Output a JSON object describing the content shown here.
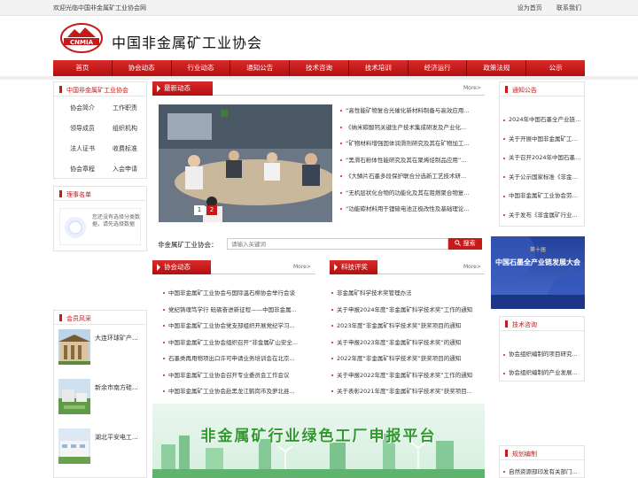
{
  "topbar": {
    "welcome": "欢迎光临中国非金属矿工业协会网",
    "set_home": "设为首页",
    "contact": "联系我们"
  },
  "header": {
    "logo_text": "CNMIA",
    "title": "中国非金属矿工业协会"
  },
  "nav": [
    "首页",
    "协会动态",
    "行业动态",
    "通知公告",
    "技术咨询",
    "技术培训",
    "经济运行",
    "政策法规",
    "公示"
  ],
  "left": {
    "assoc_title": "中国非金属矿工业协会",
    "assoc_links": [
      "协会简介",
      "工作职责",
      "领导成员",
      "组织机构",
      "法人证书",
      "收费标准",
      "协会章程",
      "入会申请"
    ],
    "council_title": "理事名单",
    "council_empty": "您还没有选择分类数据，请先选择数据",
    "members_title": "会员风采",
    "members": [
      "大连环球矿产...",
      "新余市南方硅...",
      "湖北平安电工..."
    ]
  },
  "news": {
    "title": "最新动态",
    "more": "More>",
    "items": [
      "“高性能矿物复合光催化新材料制备与高效应用...",
      "《纳米碳酸钙关键生产技术集成研发及产业化...",
      "“矿物材料增强固体润滑剂研究及其在矿物加工...",
      "“黑滑石粉体性能研究及其在聚烯烃制品应用”...",
      "《大鳞片石墨多段保护联合分选新工艺技术研...",
      "“无机层状化合物的功能化及其在阻燃聚合物复...",
      "“功能碳材料用于锂硫电池正极改性及基础理论..."
    ],
    "slide_numbers": [
      "1",
      "2"
    ]
  },
  "search": {
    "label": "非金属矿工业协会：",
    "placeholder": "请输入关键词",
    "button": "搜索"
  },
  "assoc_news": {
    "title": "协会动态",
    "more": "More>",
    "items": [
      "中国非金属矿工业协会与国际温石棉协会举行会谈",
      "党纪铸魂笃学行 砥砺奋进新征程——中国非金属...",
      "中国非金属矿工业协会党支部组织开展党纪学习...",
      "中国非金属矿工业协会组织召开“非金属矿山安全...",
      "石墨类再用物项出口许可申请业务培训会在北京...",
      "中国非金属矿工业协会召开专业委员会工作会议",
      "中国非金属矿工业协会赴黑龙江鹤岗市及萝北县..."
    ]
  },
  "tech_awards": {
    "title": "科技评奖",
    "more": "More>",
    "items": [
      "非金属矿科学技术奖管理办法",
      "关于申报2024年度“非金属矿科学技术奖”工作的通知",
      "2023年度“非金属矿科学技术奖”获奖项目的通知",
      "关于申报2023年度“非金属矿科学技术奖”的通知",
      "2022年度“非金属矿科学技术奖”获奖项目的通知",
      "关于申报2022年度“非金属矿科学技术奖”工作的通知",
      "关于表彰2021年度“非金属矿科学技术奖”获奖项目..."
    ]
  },
  "banner": {
    "text": "非金属矿行业绿色工厂申报平台"
  },
  "right": {
    "notice_title": "通知公告",
    "notices": [
      "2024年中国石墨全产业链发...",
      "关于开展中国非金属矿工业...",
      "关于召开2024年中国石墨全...",
      "关于公示国家标准《非金属...",
      "中国非金属矿工业协会劳动...",
      "关于发布《非金属矿行业..."
    ],
    "ad_top": "第十届",
    "ad_title": "中国石墨全产业链发展大会",
    "consult_title": "技术咨询",
    "consults": [
      "协会组织编制的项目研究...",
      "协会组织编制的产业发展..."
    ],
    "plan_title": "规划编制",
    "plans": [
      "自然资源部印发有关部门..."
    ]
  },
  "colors": {
    "primary_red": "#c41a1a",
    "banner_green": "#2e9a2e"
  }
}
